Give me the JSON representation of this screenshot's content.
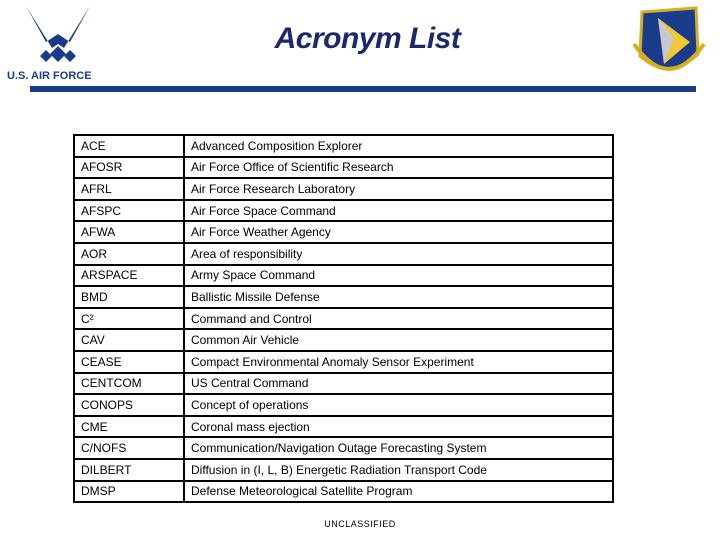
{
  "header": {
    "title": "Acronym List",
    "logo_text": "U.S. AIR FORCE",
    "brand_color": "#1a3a8a"
  },
  "rows": [
    {
      "acronym": "ACE",
      "meaning": "Advanced Composition Explorer"
    },
    {
      "acronym": "AFOSR",
      "meaning": "Air Force Office of Scientific Research"
    },
    {
      "acronym": "AFRL",
      "meaning": "Air Force Research Laboratory"
    },
    {
      "acronym": "AFSPC",
      "meaning": "Air Force Space Command"
    },
    {
      "acronym": "AFWA",
      "meaning": "Air Force Weather Agency"
    },
    {
      "acronym": "AOR",
      "meaning": "Area of responsibility"
    },
    {
      "acronym": "ARSPACE",
      "meaning": "Army Space Command"
    },
    {
      "acronym": "BMD",
      "meaning": "Ballistic Missile Defense"
    },
    {
      "acronym": "C²",
      "meaning": "Command and Control"
    },
    {
      "acronym": "CAV",
      "meaning": "Common Air Vehicle"
    },
    {
      "acronym": "CEASE",
      "meaning": "Compact Environmental Anomaly Sensor Experiment"
    },
    {
      "acronym": "CENTCOM",
      "meaning": "US Central Command"
    },
    {
      "acronym": "CONOPS",
      "meaning": "Concept of operations"
    },
    {
      "acronym": "CME",
      "meaning": "Coronal mass ejection"
    },
    {
      "acronym": "C/NOFS",
      "meaning": "Communication/Navigation Outage Forecasting System"
    },
    {
      "acronym": "DILBERT",
      "meaning": "Diffusion in (I, L, B) Energetic Radiation Transport Code"
    },
    {
      "acronym": "DMSP",
      "meaning": "Defense Meteorological Satellite Program"
    }
  ],
  "footer": {
    "classification": "UNCLASSIFIED"
  }
}
